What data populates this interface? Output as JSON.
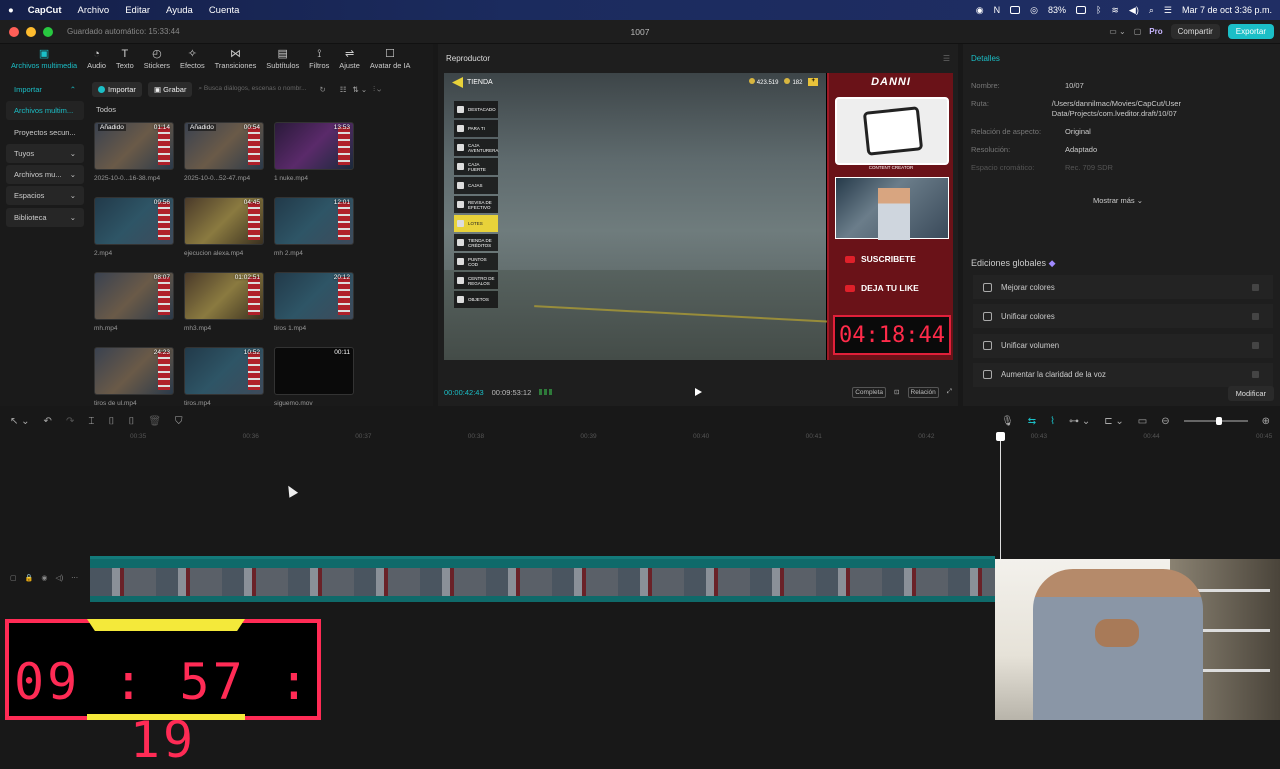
{
  "menubar": {
    "app": "CapCut",
    "items": [
      "Archivo",
      "Editar",
      "Ayuda",
      "Cuenta"
    ],
    "battery": "83%",
    "datetime": "Mar 7 de oct  3:36 p.m."
  },
  "window": {
    "autosave": "Guardado automático: 15:33:44",
    "project_title": "1007",
    "pro": "Pro",
    "share": "Compartir",
    "export": "Exportar"
  },
  "toolbar": [
    {
      "label": "Archivos multimedia",
      "icon": "media-icon",
      "active": true
    },
    {
      "label": "Audio",
      "icon": "audio-icon"
    },
    {
      "label": "Texto",
      "icon": "text-icon"
    },
    {
      "label": "Stickers",
      "icon": "sticker-icon"
    },
    {
      "label": "Efectos",
      "icon": "effects-icon"
    },
    {
      "label": "Transiciones",
      "icon": "transition-icon"
    },
    {
      "label": "Subtítulos",
      "icon": "subtitles-icon"
    },
    {
      "label": "Filtros",
      "icon": "filter-icon"
    },
    {
      "label": "Ajuste",
      "icon": "adjust-icon"
    },
    {
      "label": "Avatar de IA",
      "icon": "ai-avatar-icon"
    }
  ],
  "sidebar": [
    {
      "label": "Importar",
      "chevron": "⌃",
      "state": "act"
    },
    {
      "label": "Archivos multim...",
      "chevron": "",
      "state": "sel"
    },
    {
      "label": "Proyectos secun...",
      "chevron": "",
      "state": ""
    },
    {
      "label": "Tuyos",
      "chevron": "⌄",
      "state": "hl"
    },
    {
      "label": "Archivos mu...",
      "chevron": "⌄",
      "state": "hl"
    },
    {
      "label": "Espacios",
      "chevron": "⌄",
      "state": "hl"
    },
    {
      "label": "Biblioteca",
      "chevron": "⌄",
      "state": "hl"
    }
  ],
  "media": {
    "import": "Importar",
    "record": "Grabar",
    "search_placeholder": "Busca diálogos, escenas o nombr...",
    "filter_all": "Todos"
  },
  "thumbs": [
    {
      "name": "2025-10-0...16-38.mp4",
      "dur": "01:14",
      "added": "Añadido",
      "style": ""
    },
    {
      "name": "2025-10-0...52-47.mp4",
      "dur": "00:54",
      "added": "Añadido",
      "style": ""
    },
    {
      "name": "1 nuke.mp4",
      "dur": "13:53",
      "added": "",
      "style": "alt3"
    },
    {
      "name": "2.mp4",
      "dur": "09:56",
      "added": "",
      "style": "alt2"
    },
    {
      "name": "ejecucion alexa.mp4",
      "dur": "04:45",
      "added": "",
      "style": "alt1"
    },
    {
      "name": "mh 2.mp4",
      "dur": "12:01",
      "added": "",
      "style": "alt2"
    },
    {
      "name": "mh.mp4",
      "dur": "08:07",
      "added": "",
      "style": ""
    },
    {
      "name": "mh3.mp4",
      "dur": "01:02:51",
      "added": "",
      "style": "alt1"
    },
    {
      "name": "tiros 1.mp4",
      "dur": "20:12",
      "added": "",
      "style": "alt2"
    },
    {
      "name": "tiros de ul.mp4",
      "dur": "24:23",
      "added": "",
      "style": ""
    },
    {
      "name": "tiros.mp4",
      "dur": "10:52",
      "added": "",
      "style": "alt2"
    },
    {
      "name": "siguemo.mov",
      "dur": "00:11",
      "added": "",
      "style": "dark"
    }
  ],
  "player": {
    "title": "Reproductor",
    "current_time": "00:00:42:43",
    "total_time": "00:09:53:12",
    "full_label": "Completa",
    "ratio_label": "Relación"
  },
  "game": {
    "shop": "TIENDA",
    "coins": "423.519",
    "gems": "182",
    "menu": [
      {
        "label": "DESTACADO",
        "on": false
      },
      {
        "label": "PARA TI",
        "on": false
      },
      {
        "label": "CAJA AVENTURERA",
        "on": false
      },
      {
        "label": "CAJA FUERTE",
        "on": false
      },
      {
        "label": "CAJAS",
        "on": false
      },
      {
        "label": "REVISA DE EFECTIVO",
        "on": false
      },
      {
        "label": "LOTES",
        "on": true
      },
      {
        "label": "TIENDA DE CRÉDITOS",
        "on": false
      },
      {
        "label": "PUNTOS COD",
        "on": false
      },
      {
        "label": "CENTRO DE REGALOS",
        "on": false
      },
      {
        "label": "OBJETOS",
        "on": false
      }
    ]
  },
  "overlay": {
    "brand": "DANNI",
    "cc_label": "CONTENT CREATOR",
    "subscribe": "SUSCRIBETE",
    "like": "DEJA TU LIKE",
    "timer": "04:18:44"
  },
  "details": {
    "title": "Detalles",
    "rows": [
      {
        "k": "Nombre:",
        "v": "10/07",
        "faded": false
      },
      {
        "k": "Ruta:",
        "v": "/Users/dannilmac/Movies/CapCut/User Data/Projects/com.lveditor.draft/10/07",
        "faded": false
      },
      {
        "k": "Relación de aspecto:",
        "v": "Original",
        "faded": false
      },
      {
        "k": "Resolución:",
        "v": "Adaptado",
        "faded": false
      },
      {
        "k": "Espacio cromático:",
        "v": "Rec. 709 SDR",
        "faded": true
      }
    ],
    "more": "Mostrar más ⌄",
    "global": "Ediciones globales",
    "items": [
      "Mejorar colores",
      "Unificar colores",
      "Unificar volumen",
      "Aumentar la claridad de la voz"
    ],
    "modify": "Modificar"
  },
  "ruler": [
    "00:35",
    "00:36",
    "00:37",
    "00:38",
    "00:39",
    "00:40",
    "00:41",
    "00:42",
    "00:43",
    "00:44",
    "00:45"
  ],
  "bigtimer": "09 : 57 : 19"
}
